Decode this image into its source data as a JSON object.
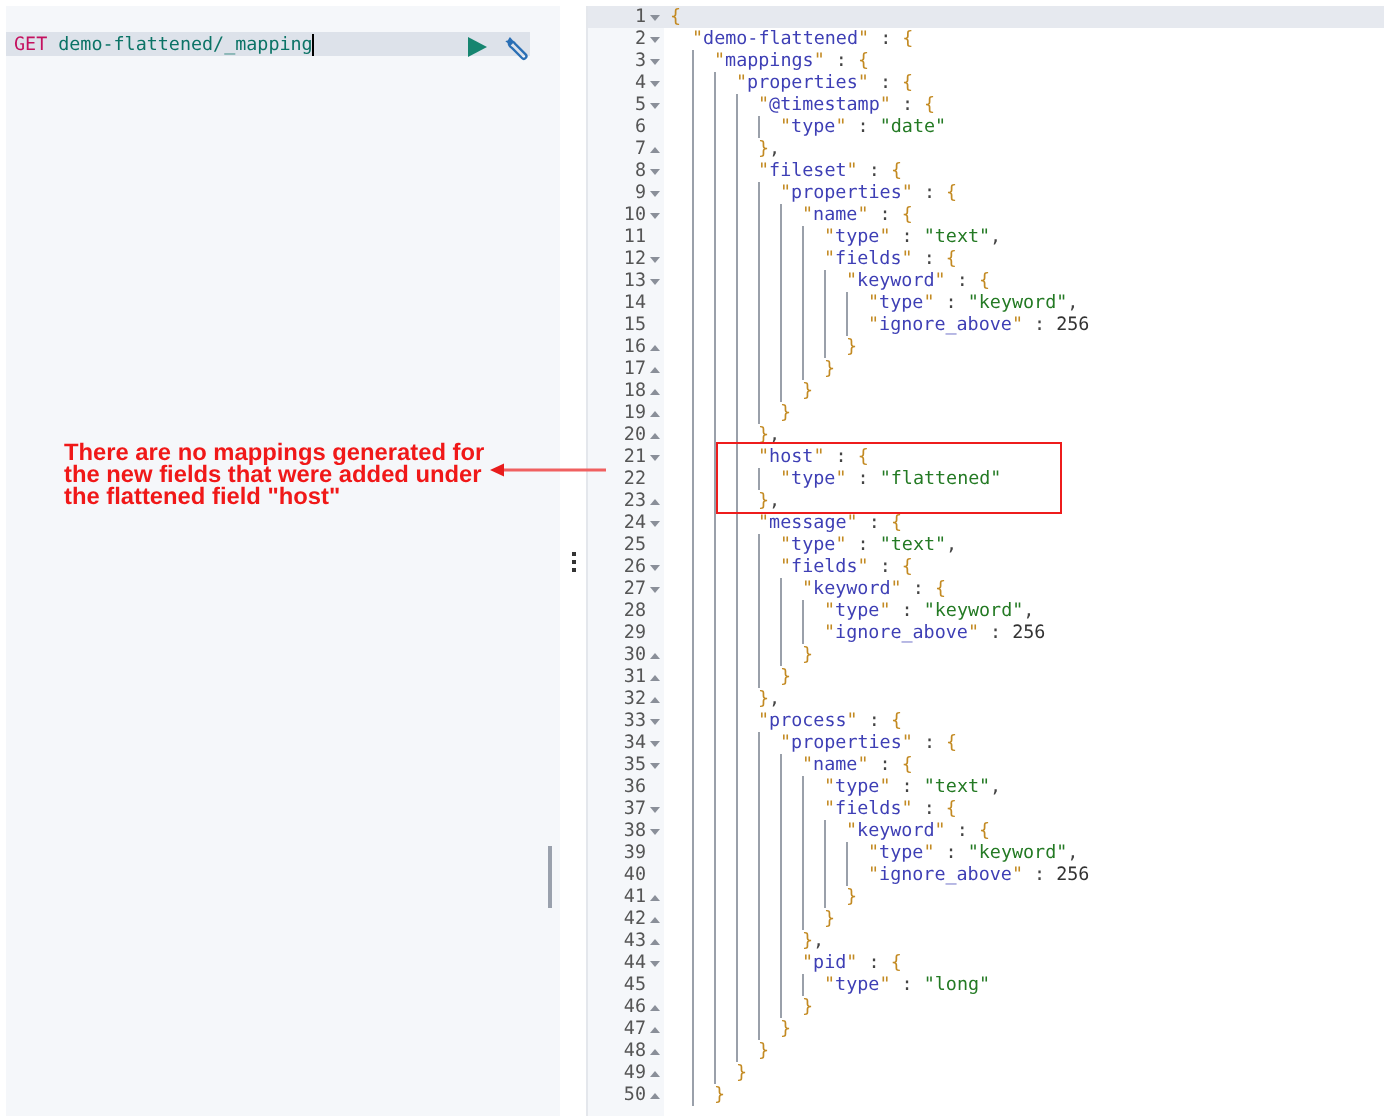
{
  "request": {
    "method": "GET",
    "path": "demo-flattened/_mapping"
  },
  "annotation": {
    "text": "There are no mappings generated for the new fields that were added under the flattened field \"host\""
  },
  "response": {
    "lines": [
      {
        "number": "1",
        "text": "{",
        "kind": "open",
        "active": true,
        "boxed": false
      },
      {
        "number": "2",
        "text": "  \"demo-flattened\" : {",
        "kind": "open",
        "active": false,
        "boxed": false
      },
      {
        "number": "3",
        "text": "    \"mappings\" : {",
        "kind": "open",
        "active": false,
        "boxed": false
      },
      {
        "number": "4",
        "text": "      \"properties\" : {",
        "kind": "open",
        "active": false,
        "boxed": false
      },
      {
        "number": "5",
        "text": "        \"@timestamp\" : {",
        "kind": "open",
        "active": false,
        "boxed": false
      },
      {
        "number": "6",
        "text": "          \"type\" : \"date\"",
        "kind": "plain",
        "active": false,
        "boxed": false
      },
      {
        "number": "7",
        "text": "        },",
        "kind": "close",
        "active": false,
        "boxed": false
      },
      {
        "number": "8",
        "text": "        \"fileset\" : {",
        "kind": "open",
        "active": false,
        "boxed": false
      },
      {
        "number": "9",
        "text": "          \"properties\" : {",
        "kind": "open",
        "active": false,
        "boxed": false
      },
      {
        "number": "10",
        "text": "            \"name\" : {",
        "kind": "open",
        "active": false,
        "boxed": false
      },
      {
        "number": "11",
        "text": "              \"type\" : \"text\",",
        "kind": "plain",
        "active": false,
        "boxed": false
      },
      {
        "number": "12",
        "text": "              \"fields\" : {",
        "kind": "open",
        "active": false,
        "boxed": false
      },
      {
        "number": "13",
        "text": "                \"keyword\" : {",
        "kind": "open",
        "active": false,
        "boxed": false
      },
      {
        "number": "14",
        "text": "                  \"type\" : \"keyword\",",
        "kind": "plain",
        "active": false,
        "boxed": false
      },
      {
        "number": "15",
        "text": "                  \"ignore_above\" : 256",
        "kind": "plain",
        "active": false,
        "boxed": false
      },
      {
        "number": "16",
        "text": "                }",
        "kind": "close",
        "active": false,
        "boxed": false
      },
      {
        "number": "17",
        "text": "              }",
        "kind": "close",
        "active": false,
        "boxed": false
      },
      {
        "number": "18",
        "text": "            }",
        "kind": "close",
        "active": false,
        "boxed": false
      },
      {
        "number": "19",
        "text": "          }",
        "kind": "close",
        "active": false,
        "boxed": false
      },
      {
        "number": "20",
        "text": "        },",
        "kind": "close",
        "active": false,
        "boxed": false
      },
      {
        "number": "21",
        "text": "        \"host\" : {",
        "kind": "open",
        "active": false,
        "boxed": true
      },
      {
        "number": "22",
        "text": "          \"type\" : \"flattened\"",
        "kind": "plain",
        "active": false,
        "boxed": true
      },
      {
        "number": "23",
        "text": "        },",
        "kind": "close",
        "active": false,
        "boxed": true
      },
      {
        "number": "24",
        "text": "        \"message\" : {",
        "kind": "open",
        "active": false,
        "boxed": false
      },
      {
        "number": "25",
        "text": "          \"type\" : \"text\",",
        "kind": "plain",
        "active": false,
        "boxed": false
      },
      {
        "number": "26",
        "text": "          \"fields\" : {",
        "kind": "open",
        "active": false,
        "boxed": false
      },
      {
        "number": "27",
        "text": "            \"keyword\" : {",
        "kind": "open",
        "active": false,
        "boxed": false
      },
      {
        "number": "28",
        "text": "              \"type\" : \"keyword\",",
        "kind": "plain",
        "active": false,
        "boxed": false
      },
      {
        "number": "29",
        "text": "              \"ignore_above\" : 256",
        "kind": "plain",
        "active": false,
        "boxed": false
      },
      {
        "number": "30",
        "text": "            }",
        "kind": "close",
        "active": false,
        "boxed": false
      },
      {
        "number": "31",
        "text": "          }",
        "kind": "close",
        "active": false,
        "boxed": false
      },
      {
        "number": "32",
        "text": "        },",
        "kind": "close",
        "active": false,
        "boxed": false
      },
      {
        "number": "33",
        "text": "        \"process\" : {",
        "kind": "open",
        "active": false,
        "boxed": false
      },
      {
        "number": "34",
        "text": "          \"properties\" : {",
        "kind": "open",
        "active": false,
        "boxed": false
      },
      {
        "number": "35",
        "text": "            \"name\" : {",
        "kind": "open",
        "active": false,
        "boxed": false
      },
      {
        "number": "36",
        "text": "              \"type\" : \"text\",",
        "kind": "plain",
        "active": false,
        "boxed": false
      },
      {
        "number": "37",
        "text": "              \"fields\" : {",
        "kind": "open",
        "active": false,
        "boxed": false
      },
      {
        "number": "38",
        "text": "                \"keyword\" : {",
        "kind": "open",
        "active": false,
        "boxed": false
      },
      {
        "number": "39",
        "text": "                  \"type\" : \"keyword\",",
        "kind": "plain",
        "active": false,
        "boxed": false
      },
      {
        "number": "40",
        "text": "                  \"ignore_above\" : 256",
        "kind": "plain",
        "active": false,
        "boxed": false
      },
      {
        "number": "41",
        "text": "                }",
        "kind": "close",
        "active": false,
        "boxed": false
      },
      {
        "number": "42",
        "text": "              }",
        "kind": "close",
        "active": false,
        "boxed": false
      },
      {
        "number": "43",
        "text": "            },",
        "kind": "close",
        "active": false,
        "boxed": false
      },
      {
        "number": "44",
        "text": "            \"pid\" : {",
        "kind": "open",
        "active": false,
        "boxed": false
      },
      {
        "number": "45",
        "text": "              \"type\" : \"long\"",
        "kind": "plain",
        "active": false,
        "boxed": false
      },
      {
        "number": "46",
        "text": "            }",
        "kind": "close",
        "active": false,
        "boxed": false
      },
      {
        "number": "47",
        "text": "          }",
        "kind": "close",
        "active": false,
        "boxed": false
      },
      {
        "number": "48",
        "text": "        }",
        "kind": "close",
        "active": false,
        "boxed": false
      },
      {
        "number": "49",
        "text": "      }",
        "kind": "close",
        "active": false,
        "boxed": false
      },
      {
        "number": "50",
        "text": "    }",
        "kind": "close",
        "active": false,
        "boxed": false
      }
    ]
  }
}
